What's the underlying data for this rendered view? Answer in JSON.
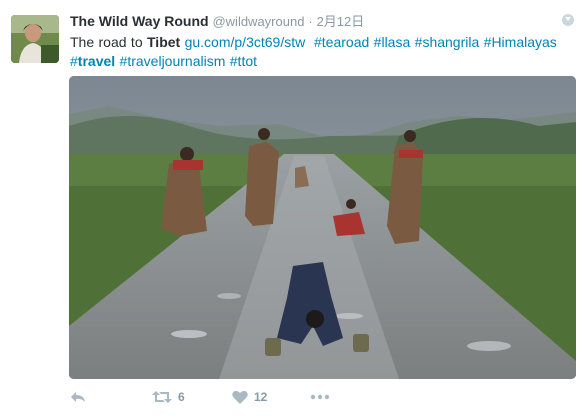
{
  "tweet": {
    "fullname": "The Wild Way Round",
    "username": "@wildwayround",
    "separator": "·",
    "timestamp": "2月12日",
    "text_parts": {
      "lead": "The road to ",
      "tibet": "Tibet",
      "link": "gu.com/p/3ct69/stw",
      "h1": "#tearoad",
      "h2": "#llasa",
      "h3": "#shangrila",
      "h4": "#Himalayas",
      "h5_hash": "#",
      "h5_word": "travel",
      "h6": "#traveljournalism",
      "h7": "#ttot"
    },
    "image_alt": "Pilgrims prostrating on a wet mountain road"
  },
  "actions": {
    "reply_icon": "reply-icon",
    "retweet_icon": "retweet-icon",
    "retweet_count": "6",
    "like_icon": "heart-icon",
    "like_count": "12",
    "more_icon": "more-icon"
  },
  "colors": {
    "link": "#0084b4",
    "meta": "#8899a6",
    "icon": "#aab8c2",
    "text": "#292f33"
  }
}
